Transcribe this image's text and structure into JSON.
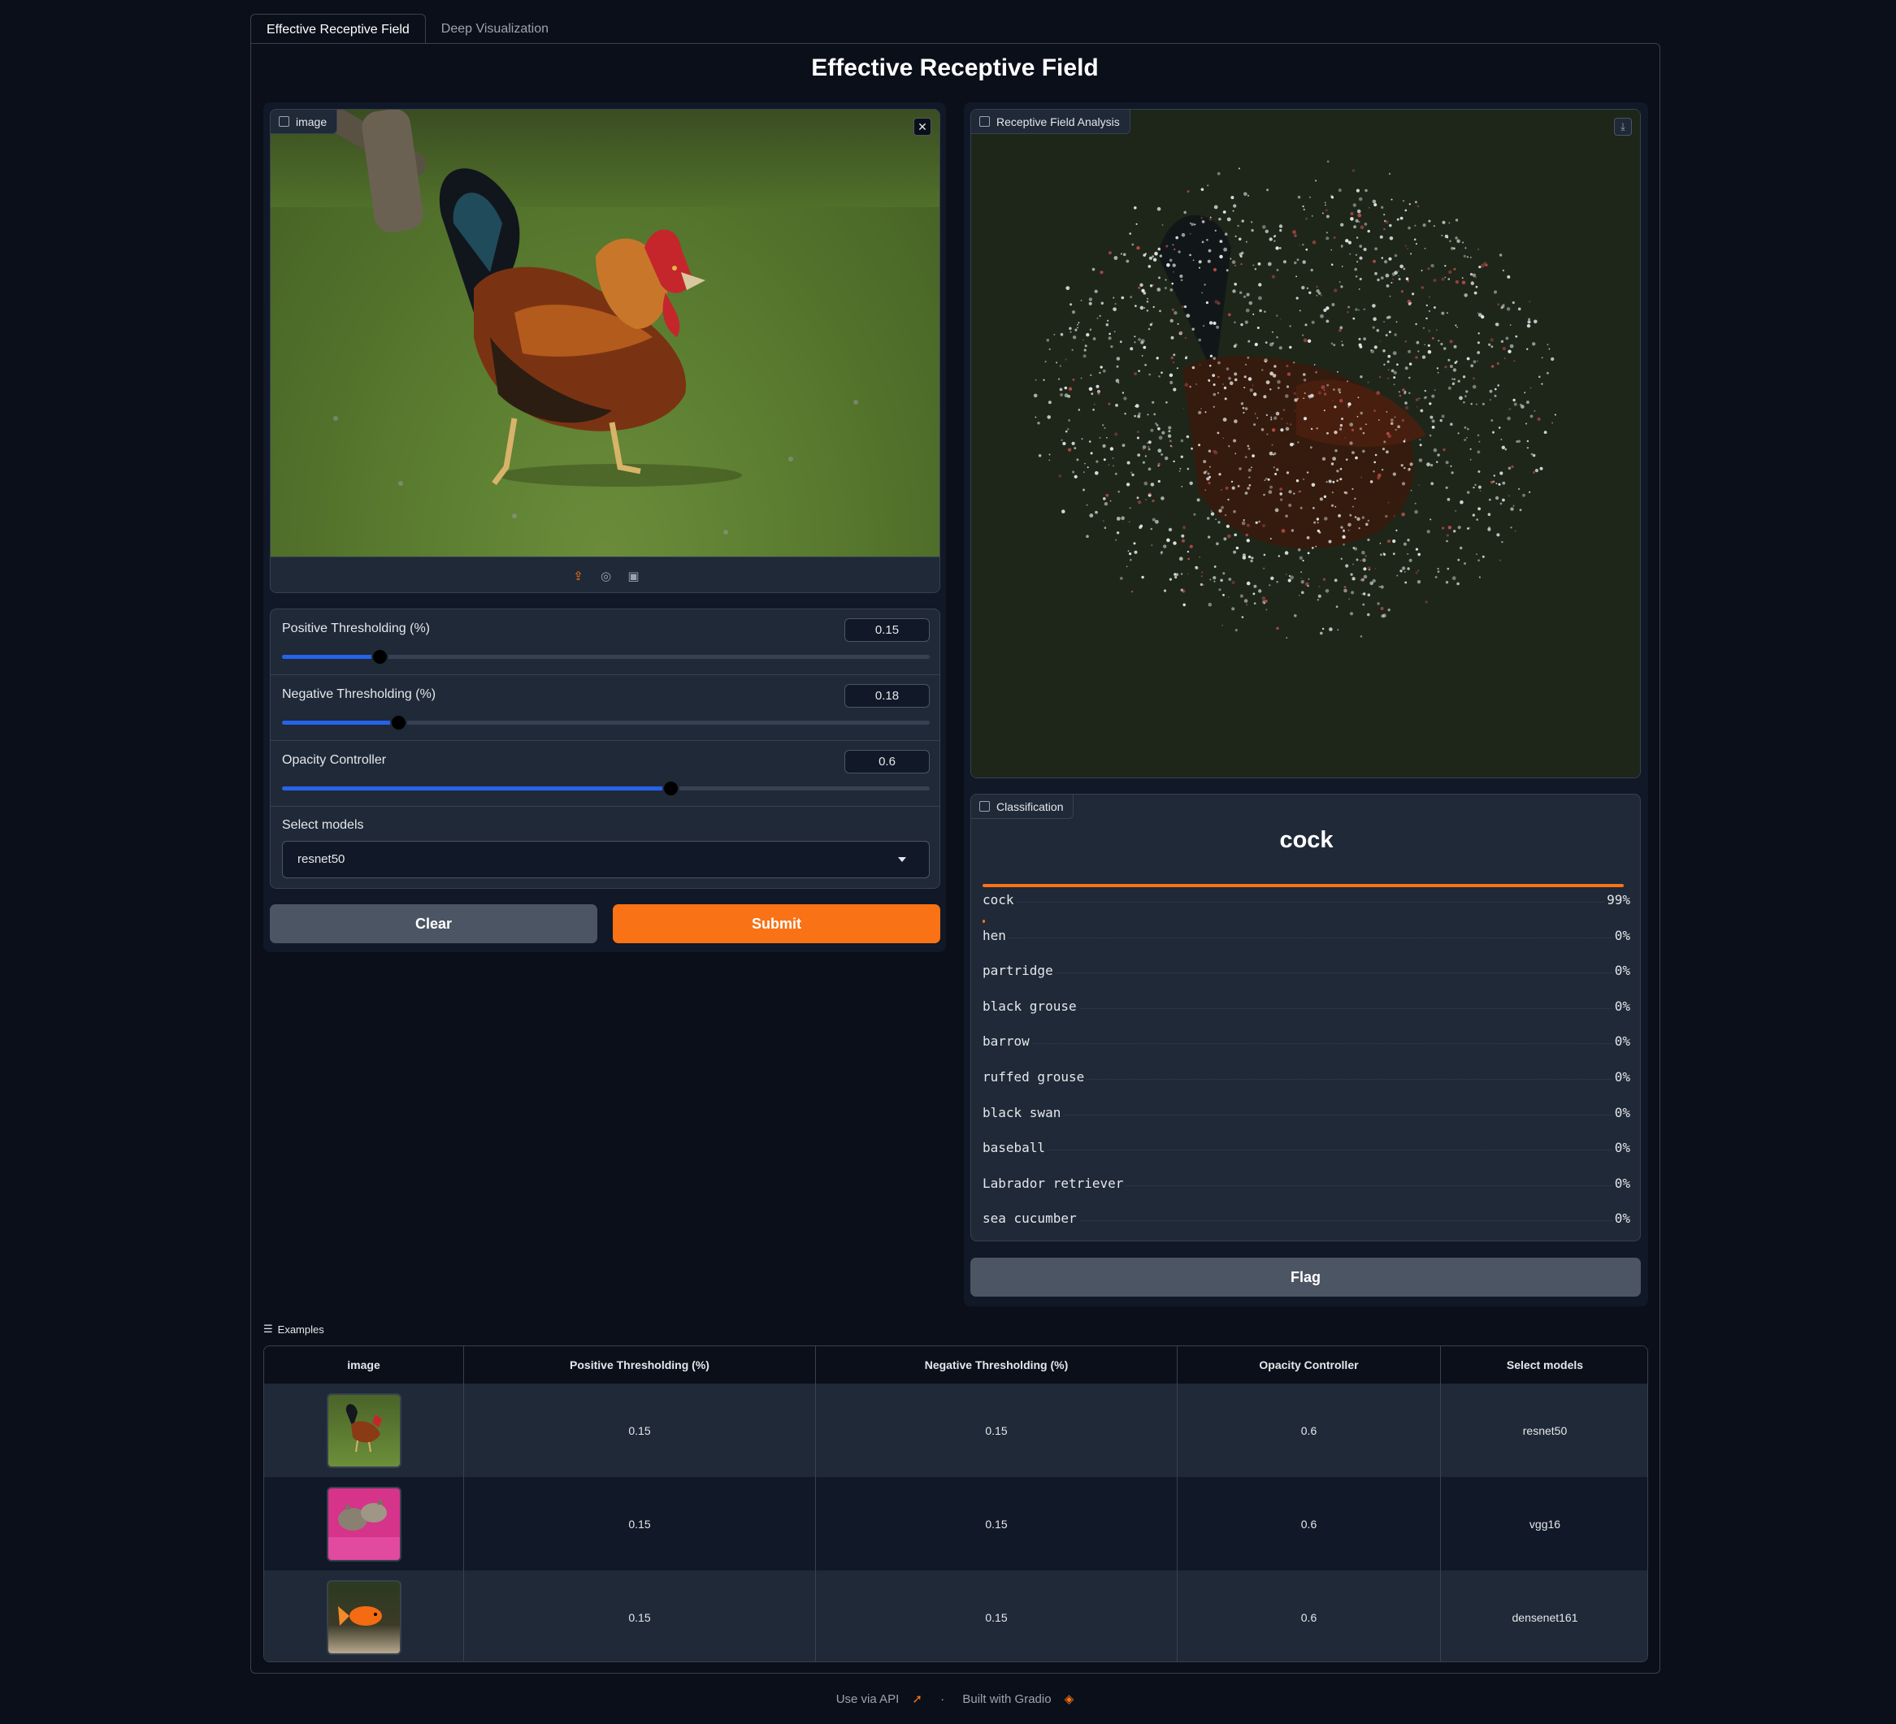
{
  "tabs": [
    {
      "label": "Effective Receptive Field",
      "active": true
    },
    {
      "label": "Deep Visualization",
      "active": false
    }
  ],
  "page_title": "Effective Receptive Field",
  "input_image": {
    "label": "image",
    "icon": "image-icon"
  },
  "output_image": {
    "label": "Receptive Field Analysis",
    "icon": "image-icon"
  },
  "sliders": [
    {
      "label": "Positive Thresholding (%)",
      "value": "0.15",
      "fraction": 0.15
    },
    {
      "label": "Negative Thresholding (%)",
      "value": "0.18",
      "fraction": 0.18
    },
    {
      "label": "Opacity Controller",
      "value": "0.6",
      "fraction": 0.6
    }
  ],
  "select_models": {
    "label": "Select models",
    "value": "resnet50"
  },
  "buttons": {
    "clear": "Clear",
    "submit": "Submit",
    "flag": "Flag"
  },
  "classification": {
    "label": "Classification",
    "top_label": "cock",
    "rows": [
      {
        "name": "cock",
        "pct": "99%",
        "fraction": 0.99
      },
      {
        "name": "hen",
        "pct": "0%",
        "fraction": 0.004
      },
      {
        "name": "partridge",
        "pct": "0%",
        "fraction": 0
      },
      {
        "name": "black grouse",
        "pct": "0%",
        "fraction": 0
      },
      {
        "name": "barrow",
        "pct": "0%",
        "fraction": 0
      },
      {
        "name": "ruffed grouse",
        "pct": "0%",
        "fraction": 0
      },
      {
        "name": "black swan",
        "pct": "0%",
        "fraction": 0
      },
      {
        "name": "baseball",
        "pct": "0%",
        "fraction": 0
      },
      {
        "name": "Labrador retriever",
        "pct": "0%",
        "fraction": 0
      },
      {
        "name": "sea cucumber",
        "pct": "0%",
        "fraction": 0
      }
    ]
  },
  "examples": {
    "label": "Examples",
    "headers": [
      "image",
      "Positive Thresholding (%)",
      "Negative Thresholding (%)",
      "Opacity Controller",
      "Select models"
    ],
    "rows": [
      {
        "pos": "0.15",
        "neg": "0.15",
        "opacity": "0.6",
        "model": "resnet50"
      },
      {
        "pos": "0.15",
        "neg": "0.15",
        "opacity": "0.6",
        "model": "vgg16"
      },
      {
        "pos": "0.15",
        "neg": "0.15",
        "opacity": "0.6",
        "model": "densenet161"
      }
    ]
  },
  "footer": {
    "api": "Use via API",
    "built": "Built with Gradio",
    "separator": "·"
  },
  "colors": {
    "accent": "#f97316",
    "slider": "#2563eb",
    "background": "#0b0f19",
    "panel": "#1f2937"
  }
}
